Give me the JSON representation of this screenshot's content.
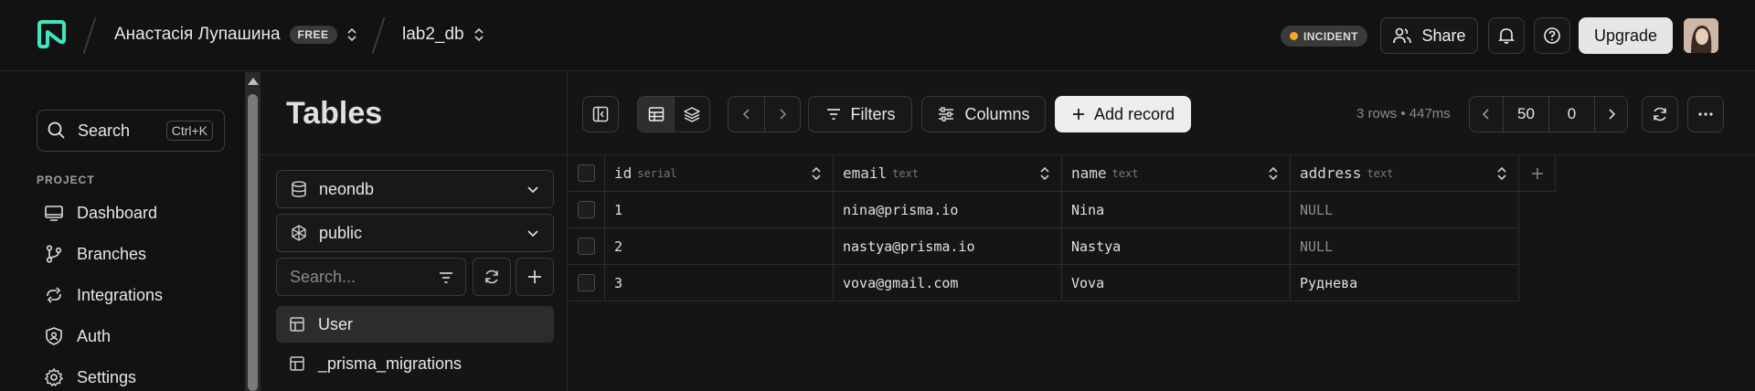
{
  "header": {
    "user_name": "Анастасія Лупашина",
    "plan_badge": "FREE",
    "project_name": "lab2_db",
    "incident_label": "INCIDENT",
    "share_label": "Share",
    "upgrade_label": "Upgrade",
    "brand_color": "#3ee6c1"
  },
  "sidebar": {
    "search_label": "Search",
    "search_shortcut": "Ctrl+K",
    "section_label": "PROJECT",
    "items": [
      {
        "label": "Dashboard",
        "icon": "monitor-icon"
      },
      {
        "label": "Branches",
        "icon": "git-branch-icon"
      },
      {
        "label": "Integrations",
        "icon": "integrations-icon"
      },
      {
        "label": "Auth",
        "icon": "shield-user-icon"
      },
      {
        "label": "Settings",
        "icon": "gear-icon"
      }
    ]
  },
  "tables_panel": {
    "title": "Tables",
    "database": "neondb",
    "schema": "public",
    "search_placeholder": "Search...",
    "tables": [
      {
        "name": "User",
        "active": true
      },
      {
        "name": "_prisma_migrations",
        "active": false
      }
    ]
  },
  "toolbar": {
    "filters_label": "Filters",
    "columns_label": "Columns",
    "add_record_label": "Add record",
    "stats": "3 rows • 447ms",
    "page_limit": "50",
    "page_offset": "0"
  },
  "grid": {
    "columns": [
      {
        "name": "id",
        "type": "serial"
      },
      {
        "name": "email",
        "type": "text"
      },
      {
        "name": "name",
        "type": "text"
      },
      {
        "name": "address",
        "type": "text"
      }
    ],
    "rows": [
      {
        "id": "1",
        "email": "nina@prisma.io",
        "name": "Nina",
        "address": "NULL"
      },
      {
        "id": "2",
        "email": "nastya@prisma.io",
        "name": "Nastya",
        "address": "NULL"
      },
      {
        "id": "3",
        "email": "vova@gmail.com",
        "name": "Vova",
        "address": "Руднева"
      }
    ]
  }
}
